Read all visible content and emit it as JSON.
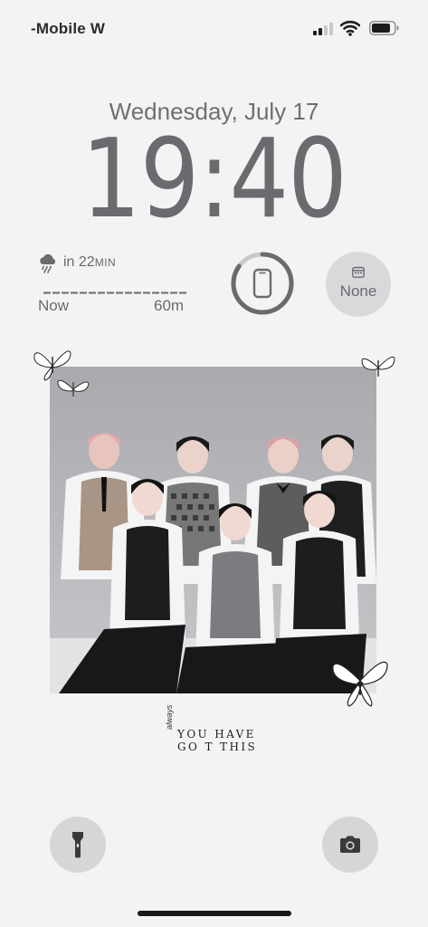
{
  "status_bar": {
    "carrier": "-Mobile W",
    "signal_bars_filled": 2,
    "signal_bars_total": 4,
    "wifi": true,
    "battery_level": 0.85
  },
  "lock": {
    "date": "Wednesday, July 17",
    "time": "19:40"
  },
  "widgets": {
    "rain": {
      "icon": "cloud-rain-icon",
      "prefix": "in 22",
      "unit": "MIN",
      "start_label": "Now",
      "end_label": "60m"
    },
    "battery_ring": {
      "icon": "phone-icon",
      "level": 0.85
    },
    "calendar": {
      "icon": "calendar-icon",
      "label": "None"
    }
  },
  "wallpaper": {
    "quote_line1": "YOU HAVE",
    "quote_line2": "GO T THIS",
    "quote_script": "always"
  },
  "controls": {
    "flashlight_icon": "flashlight-icon",
    "camera_icon": "camera-icon"
  }
}
